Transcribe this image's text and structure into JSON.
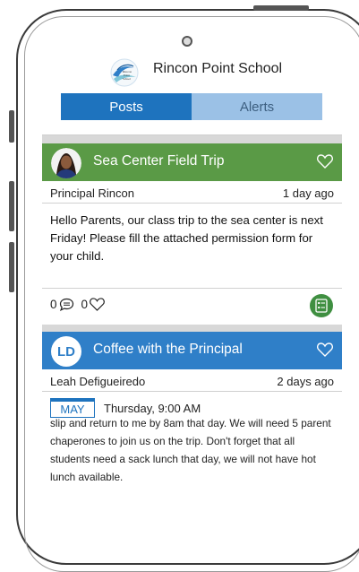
{
  "header": {
    "school_name": "Rincon Point School",
    "logo_text": "Rincon Point School"
  },
  "tabs": [
    {
      "label": "Posts",
      "active": true
    },
    {
      "label": "Alerts",
      "active": false
    }
  ],
  "posts": [
    {
      "title": "Sea Center Field Trip",
      "author": "Principal Rincon",
      "time": "1 day ago",
      "body": "Hello Parents, our class trip to the sea center is next Friday! Please fill the attached permission form for your child.",
      "comments": "0",
      "likes": "0",
      "header_color": "#5a9a46"
    },
    {
      "title": "Coffee with the Principal",
      "avatar_initials": "LD",
      "author": "Leah Defigueiredo",
      "time": "2 days ago",
      "event_month": "MAY",
      "event_time": "Thursday, 9:00 AM",
      "body": "slip and return to me by 8am that day. We will need 5 parent chaperones to join us on the trip. Don't forget that all students need a sack lunch that day, we will not have hot lunch available.",
      "header_color": "#2f7fc8"
    }
  ],
  "colors": {
    "tab_active": "#1e73be",
    "tab_inactive": "#9bc1e6",
    "form_button": "#3f8f41"
  }
}
